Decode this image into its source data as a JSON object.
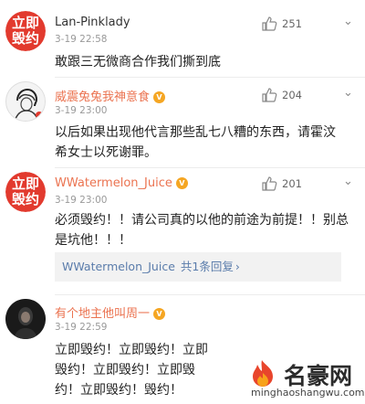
{
  "comments": [
    {
      "avatar_text": [
        "立即",
        "毁约"
      ],
      "username": "Lan-Pinklady",
      "time": "3-19 22:58",
      "likes": "251",
      "text": "敢跟三无微商合作我们撕到底"
    },
    {
      "username": "威震兔兔我神意食",
      "time": "3-19 23:00",
      "likes": "204",
      "text": "以后如果出现他代言那些乱七八糟的东西，请霍汶希女士以死谢罪。"
    },
    {
      "avatar_text": [
        "立即",
        "毁约"
      ],
      "username": "WWatermelon_Juice",
      "time": "3-19 23:00",
      "likes": "201",
      "text": "必须毁约！！请公司真的以他的前途为前提！！别总是坑他！！！",
      "reply": {
        "username": "WWatermelon_Juice",
        "summary": "共1条回复",
        "arrow": "›"
      }
    },
    {
      "username": "有个地主他叫周一",
      "time": "3-19 22:59",
      "likes": "",
      "text": "立即毁约！立即毁约！立即毁约！立即毁约！立即毁约！立即毁约！毁约！"
    }
  ],
  "more_icon": "chevron-down",
  "like_icon": "thumbs-up",
  "watermark": {
    "title": "名豪网",
    "url": "minghaoshangwu.com"
  },
  "colors": {
    "username_orange": "#eb7350",
    "avatar_red": "#e23a2e",
    "link_blue": "#5a7cab"
  }
}
